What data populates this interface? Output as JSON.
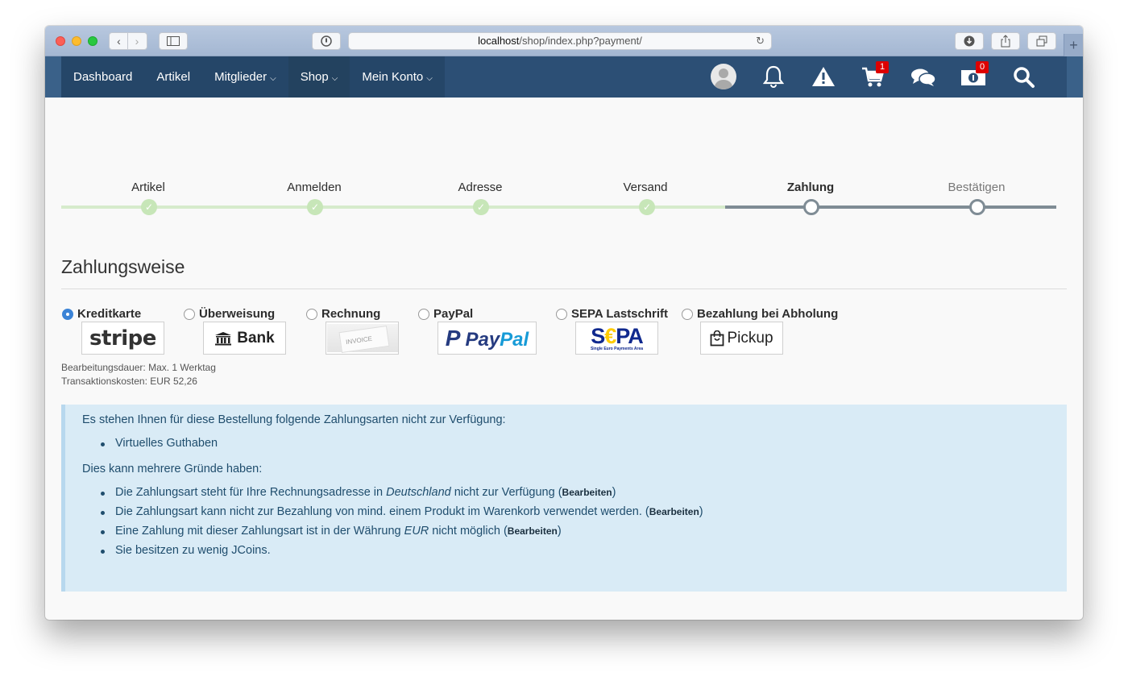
{
  "browser": {
    "url_host": "localhost",
    "url_path": "/shop/index.php?payment/",
    "back_icon": "chevron-left",
    "forward_icon": "chevron-right",
    "sidebar_icon": "sidebar",
    "reader_icon": "reader",
    "reload_icon": "reload",
    "download_icon": "download",
    "share_icon": "share",
    "tabs_icon": "tabs",
    "new_tab_label": "+"
  },
  "nav": {
    "items": [
      {
        "label": "Dashboard"
      },
      {
        "label": "Artikel"
      },
      {
        "label": "Mitglieder"
      },
      {
        "label": "Shop"
      },
      {
        "label": "Mein Konto"
      }
    ],
    "cart_badge": "1",
    "coins_badge": "0"
  },
  "progress": {
    "steps": [
      {
        "label": "Artikel",
        "state": "done"
      },
      {
        "label": "Anmelden",
        "state": "done"
      },
      {
        "label": "Adresse",
        "state": "done"
      },
      {
        "label": "Versand",
        "state": "done"
      },
      {
        "label": "Zahlung",
        "state": "current"
      },
      {
        "label": "Bestätigen",
        "state": "future"
      }
    ]
  },
  "payment": {
    "title": "Zahlungsweise",
    "options": [
      {
        "label": "Kreditkarte",
        "logo": "stripe",
        "selected": true
      },
      {
        "label": "Überweisung",
        "logo": "Bank",
        "selected": false
      },
      {
        "label": "Rechnung",
        "logo": "INVOICE",
        "selected": false
      },
      {
        "label": "PayPal",
        "logo": "PayPal",
        "selected": false
      },
      {
        "label": "SEPA Lastschrift",
        "logo": "SEPA",
        "selected": false
      },
      {
        "label": "Bezahlung bei Abholung",
        "logo": "Pickup",
        "selected": false
      }
    ],
    "logo_pay": "Pay",
    "logo_pal": "Pal",
    "logo_sepa_s": "S",
    "logo_sepa_e": "€",
    "logo_sepa_pa": "PA",
    "logo_sepa_sub": "Single Euro Payments Area",
    "processing_time": "Bearbeitungsdauer: Max. 1 Werktag",
    "transaction_cost": "Transaktionskosten: EUR 52,26"
  },
  "notice": {
    "intro": "Es stehen Ihnen für diese Bestellung folgende Zahlungsarten nicht zur Verfügung:",
    "unavailable": [
      "Virtuelles Guthaben"
    ],
    "reasons_intro": "Dies kann mehrere Gründe haben:",
    "reason1_before": "Die Zahlungsart steht für Ihre Rechnungsadresse in ",
    "reason1_country": "Deutschland",
    "reason1_after": " nicht zur Verfügung (",
    "reason2": "Die Zahlungsart kann nicht zur Bezahlung von mind. einem Produkt im Warenkorb verwendet werden. (",
    "reason3_before": "Eine Zahlung mit dieser Zahlungsart ist in der Währung ",
    "reason3_currency": "EUR",
    "reason3_after": " nicht möglich (",
    "reason4": "Sie besitzen zu wenig JCoins.",
    "edit_label": "Bearbeiten",
    "close_paren": ")"
  },
  "colors": {
    "nav_bg": "#2c4f75",
    "progress_done": "#d6ebcc",
    "progress_todo": "#7f8c95",
    "notice_bg": "#d9ebf6",
    "radio_selected": "#3b83d6"
  }
}
